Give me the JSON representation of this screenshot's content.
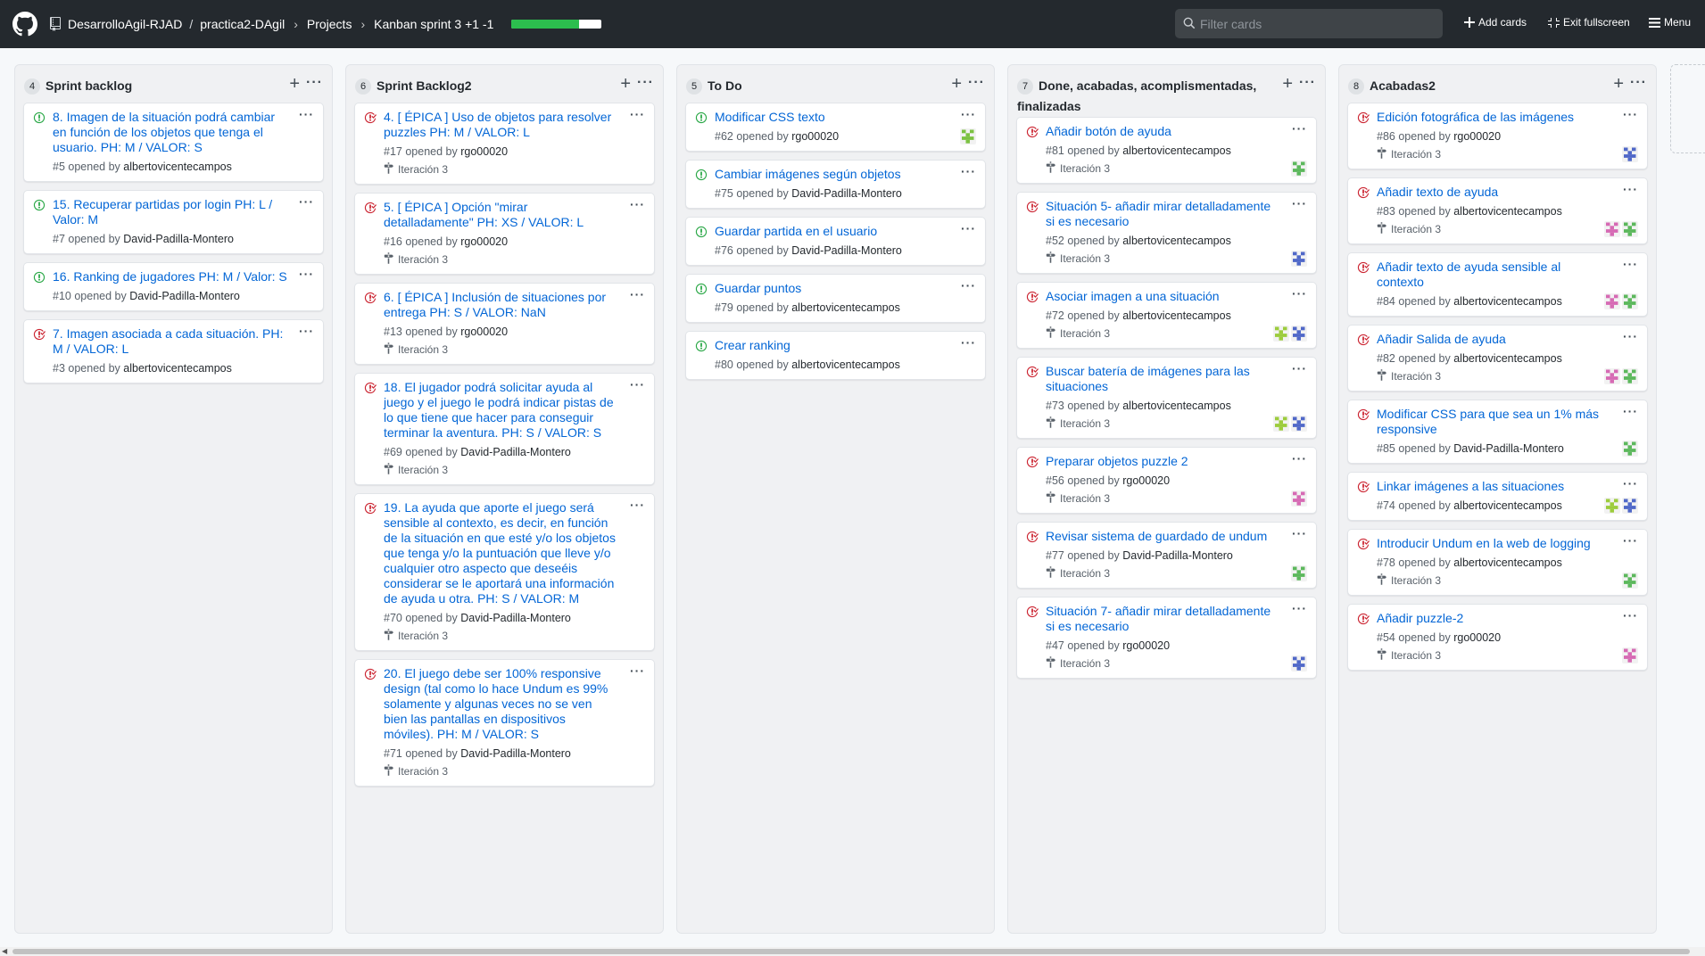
{
  "header": {
    "repo_owner": "DesarrolloAgil-RJAD",
    "repo_sep": "/",
    "repo_name": "practica2-DAgil",
    "projects": "Projects",
    "project_name": "Kanban sprint 3 +1 -1",
    "progress_percent": 75,
    "filter_placeholder": "Filter cards",
    "add_cards": "Add cards",
    "exit_fullscreen": "Exit fullscreen",
    "menu": "Menu"
  },
  "colors": {
    "open": "#28a745",
    "closed": "#cb2431",
    "link": "#0366d6"
  },
  "columns": [
    {
      "count": "4",
      "name": "Sprint backlog",
      "cards": [
        {
          "state": "open",
          "title": "8. Imagen de la situación podrá cambiar en función de los objetos que tenga el usuario. PH: M / VALOR: S",
          "number": "#5",
          "opened": "opened by",
          "author": "albertovicentecampos",
          "milestone": "",
          "avatars": []
        },
        {
          "state": "open",
          "title": "15. Recuperar partidas por login PH: L / Valor: M",
          "number": "#7",
          "opened": "opened by",
          "author": "David-Padilla-Montero",
          "milestone": "",
          "avatars": []
        },
        {
          "state": "open",
          "title": "16. Ranking de jugadores PH: M / Valor: S",
          "number": "#10",
          "opened": "opened by",
          "author": "David-Padilla-Montero",
          "milestone": "",
          "avatars": []
        },
        {
          "state": "closed",
          "title": "7. Imagen asociada a cada situación. PH: M / VALOR: L",
          "number": "#3",
          "opened": "opened by",
          "author": "albertovicentecampos",
          "milestone": "",
          "avatars": []
        }
      ]
    },
    {
      "count": "6",
      "name": "Sprint Backlog2",
      "cards": [
        {
          "state": "closed",
          "title": "4. [ ÉPICA ] Uso de objetos para resolver puzzles PH: M / VALOR: L",
          "number": "#17",
          "opened": "opened by",
          "author": "rgo00020",
          "milestone": "Iteración 3",
          "avatars": []
        },
        {
          "state": "closed",
          "title": "5. [ ÉPICA ] Opción \"mirar detalladamente\" PH: XS / VALOR: L",
          "number": "#16",
          "opened": "opened by",
          "author": "rgo00020",
          "milestone": "Iteración 3",
          "avatars": []
        },
        {
          "state": "closed",
          "title": "6. [ ÉPICA ] Inclusión de situaciones por entrega PH: S / VALOR: NaN",
          "number": "#13",
          "opened": "opened by",
          "author": "rgo00020",
          "milestone": "Iteración 3",
          "avatars": []
        },
        {
          "state": "closed",
          "title": "18. El jugador podrá solicitar ayuda al juego y el juego le podrá indicar pistas de lo que tiene que hacer para conseguir terminar la aventura. PH: S / VALOR: S",
          "number": "#69",
          "opened": "opened by",
          "author": "David-Padilla-Montero",
          "milestone": "Iteración 3",
          "avatars": []
        },
        {
          "state": "closed",
          "title": "19. La ayuda que aporte el juego será sensible al contexto, es decir, en función de la situación en que esté y/o los objetos que tenga y/o la puntuación que lleve y/o cualquier otro aspecto que deseéis considerar se le aportará una información de ayuda u otra. PH: S / VALOR: M",
          "number": "#70",
          "opened": "opened by",
          "author": "David-Padilla-Montero",
          "milestone": "Iteración 3",
          "avatars": []
        },
        {
          "state": "closed",
          "title": "20. El juego debe ser 100% responsive design (tal como lo hace Undum es 99% solamente y algunas veces no se ven bien las pantallas en dispositivos móviles). PH: M / VALOR: S",
          "number": "#71",
          "opened": "opened by",
          "author": "David-Padilla-Montero",
          "milestone": "Iteración 3",
          "avatars": []
        }
      ]
    },
    {
      "count": "5",
      "name": "To Do",
      "cards": [
        {
          "state": "open",
          "title": "Modificar CSS texto",
          "number": "#62",
          "opened": "opened by",
          "author": "rgo00020",
          "milestone": "",
          "avatars": [
            "#7cc242"
          ]
        },
        {
          "state": "open",
          "title": "Cambiar imágenes según objetos",
          "number": "#75",
          "opened": "opened by",
          "author": "David-Padilla-Montero",
          "milestone": "",
          "avatars": []
        },
        {
          "state": "open",
          "title": "Guardar partida en el usuario",
          "number": "#76",
          "opened": "opened by",
          "author": "David-Padilla-Montero",
          "milestone": "",
          "avatars": []
        },
        {
          "state": "open",
          "title": "Guardar puntos",
          "number": "#79",
          "opened": "opened by",
          "author": "albertovicentecampos",
          "milestone": "",
          "avatars": []
        },
        {
          "state": "open",
          "title": "Crear ranking",
          "number": "#80",
          "opened": "opened by",
          "author": "albertovicentecampos",
          "milestone": "",
          "avatars": []
        }
      ]
    },
    {
      "count": "7",
      "name": "Done, acabadas, acomplismentadas, finalizadas",
      "cards": [
        {
          "state": "closed",
          "title": "Añadir botón de ayuda",
          "number": "#81",
          "opened": "opened by",
          "author": "albertovicentecampos",
          "milestone": "Iteración 3",
          "avatars": [
            "#5cb85c"
          ]
        },
        {
          "state": "closed",
          "title": "Situación 5- añadir mirar detalladamente si es necesario",
          "number": "#52",
          "opened": "opened by",
          "author": "albertovicentecampos",
          "milestone": "Iteración 3",
          "avatars": [
            "#5068c8"
          ]
        },
        {
          "state": "closed",
          "title": "Asociar imagen a una situación",
          "number": "#72",
          "opened": "opened by",
          "author": "albertovicentecampos",
          "milestone": "Iteración 3",
          "avatars": [
            "#9ccc3c",
            "#5068c8"
          ]
        },
        {
          "state": "closed",
          "title": "Buscar batería de imágenes para las situaciones",
          "number": "#73",
          "opened": "opened by",
          "author": "albertovicentecampos",
          "milestone": "Iteración 3",
          "avatars": [
            "#9ccc3c",
            "#5068c8"
          ]
        },
        {
          "state": "closed",
          "title": "Preparar objetos puzzle 2",
          "number": "#56",
          "opened": "opened by",
          "author": "rgo00020",
          "milestone": "Iteración 3",
          "avatars": [
            "#d66ab4"
          ]
        },
        {
          "state": "closed",
          "title": "Revisar sistema de guardado de undum",
          "number": "#77",
          "opened": "opened by",
          "author": "David-Padilla-Montero",
          "milestone": "Iteración 3",
          "avatars": [
            "#5cb85c"
          ]
        },
        {
          "state": "closed",
          "title": "Situación 7- añadir mirar detalladamente si es necesario",
          "number": "#47",
          "opened": "opened by",
          "author": "rgo00020",
          "milestone": "Iteración 3",
          "avatars": [
            "#5068c8"
          ]
        }
      ]
    },
    {
      "count": "8",
      "name": "Acabadas2",
      "cards": [
        {
          "state": "closed",
          "title": "Edición fotográfica de las imágenes",
          "number": "#86",
          "opened": "opened by",
          "author": "rgo00020",
          "milestone": "Iteración 3",
          "avatars": [
            "#5068c8"
          ]
        },
        {
          "state": "closed",
          "title": "Añadir texto de ayuda",
          "number": "#83",
          "opened": "opened by",
          "author": "albertovicentecampos",
          "milestone": "Iteración 3",
          "avatars": [
            "#d66ab4",
            "#5cb85c"
          ]
        },
        {
          "state": "closed",
          "title": "Añadir texto de ayuda sensible al contexto",
          "number": "#84",
          "opened": "opened by",
          "author": "albertovicentecampos",
          "milestone": "",
          "avatars": [
            "#d66ab4",
            "#5cb85c"
          ]
        },
        {
          "state": "closed",
          "title": "Añadir Salida de ayuda",
          "number": "#82",
          "opened": "opened by",
          "author": "albertovicentecampos",
          "milestone": "Iteración 3",
          "avatars": [
            "#d66ab4",
            "#5cb85c"
          ]
        },
        {
          "state": "closed",
          "title": "Modificar CSS para que sea un 1% más responsive",
          "number": "#85",
          "opened": "opened by",
          "author": "David-Padilla-Montero",
          "milestone": "",
          "avatars": [
            "#5cb85c"
          ]
        },
        {
          "state": "closed",
          "title": "Linkar imágenes a las situaciones",
          "number": "#74",
          "opened": "opened by",
          "author": "albertovicentecampos",
          "milestone": "",
          "avatars": [
            "#9ccc3c",
            "#5068c8"
          ]
        },
        {
          "state": "closed",
          "title": "Introducir Undum en la web de logging",
          "number": "#78",
          "opened": "opened by",
          "author": "albertovicentecampos",
          "milestone": "Iteración 3",
          "avatars": [
            "#5cb85c"
          ]
        },
        {
          "state": "closed",
          "title": "Añadir puzzle-2",
          "number": "#54",
          "opened": "opened by",
          "author": "rgo00020",
          "milestone": "Iteración 3",
          "avatars": [
            "#d66ab4"
          ]
        }
      ]
    }
  ]
}
